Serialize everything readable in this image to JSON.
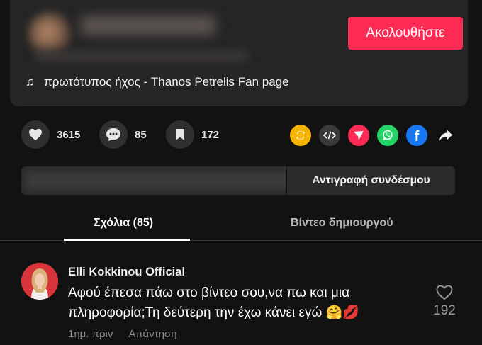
{
  "header": {
    "follow_label": "Ακολουθήστε",
    "music_icon": "music-note-icon",
    "music_label": "πρωτότυπος ήχος - Thanos Petrelis Fan page"
  },
  "actions": {
    "likes": "3615",
    "comments": "85",
    "saves": "172",
    "share_icons": [
      "repost-icon",
      "embed-icon",
      "send-icon",
      "whatsapp-icon",
      "facebook-icon",
      "share-arrow-icon"
    ]
  },
  "link": {
    "copy_label": "Αντιγραφή συνδέσμου"
  },
  "tabs": {
    "comments": "Σχόλια (85)",
    "creator_videos": "Βίντεο δημιουργού"
  },
  "comment": {
    "author": "Elli Kokkinou Official",
    "text": "Αφού έπεσα πάω στο βίντεο σου,να πω και μια πληροφορία;Τη δεύτερη την έχω κάνει εγώ 🤗💋",
    "time": "1ημ. πριν",
    "reply": "Απάντηση",
    "likes": "192"
  },
  "colors": {
    "accent": "#fe2c55",
    "repost": "#f7b500",
    "embed": "#3a3a3a",
    "send": "#fe2c55",
    "whatsapp": "#25d366",
    "facebook": "#1877f2"
  }
}
